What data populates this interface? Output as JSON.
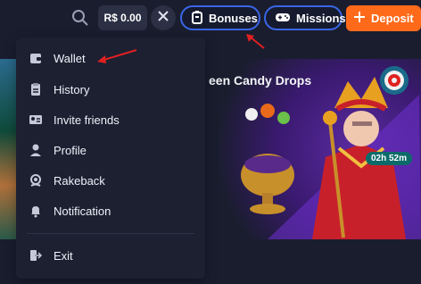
{
  "topbar": {
    "balance": "R$ 0.00",
    "bonuses_label": "Bonuses",
    "missions_label": "Missions",
    "deposit_label": "Deposit",
    "icons": [
      "search-icon",
      "close-icon",
      "gift-icon",
      "gamepad-icon",
      "plus-icon"
    ]
  },
  "menu": {
    "items": [
      {
        "label": "Wallet",
        "icon": "wallet-icon"
      },
      {
        "label": "History",
        "icon": "clipboard-icon"
      },
      {
        "label": "Invite friends",
        "icon": "id-card-icon"
      },
      {
        "label": "Profile",
        "icon": "user-icon"
      },
      {
        "label": "Rakeback",
        "icon": "rakeback-icon"
      },
      {
        "label": "Notification",
        "icon": "bell-icon"
      }
    ],
    "exit_label": "Exit",
    "exit_icon": "logout-icon"
  },
  "banner": {
    "title": "een Candy Drops",
    "timer": "02h 52m"
  },
  "colors": {
    "background": "#1a1d2e",
    "menu": "#1d2031",
    "accent_blue": "#3a66e6",
    "deposit_orange": "#ff6a1a",
    "annotation_red": "#e02020"
  }
}
